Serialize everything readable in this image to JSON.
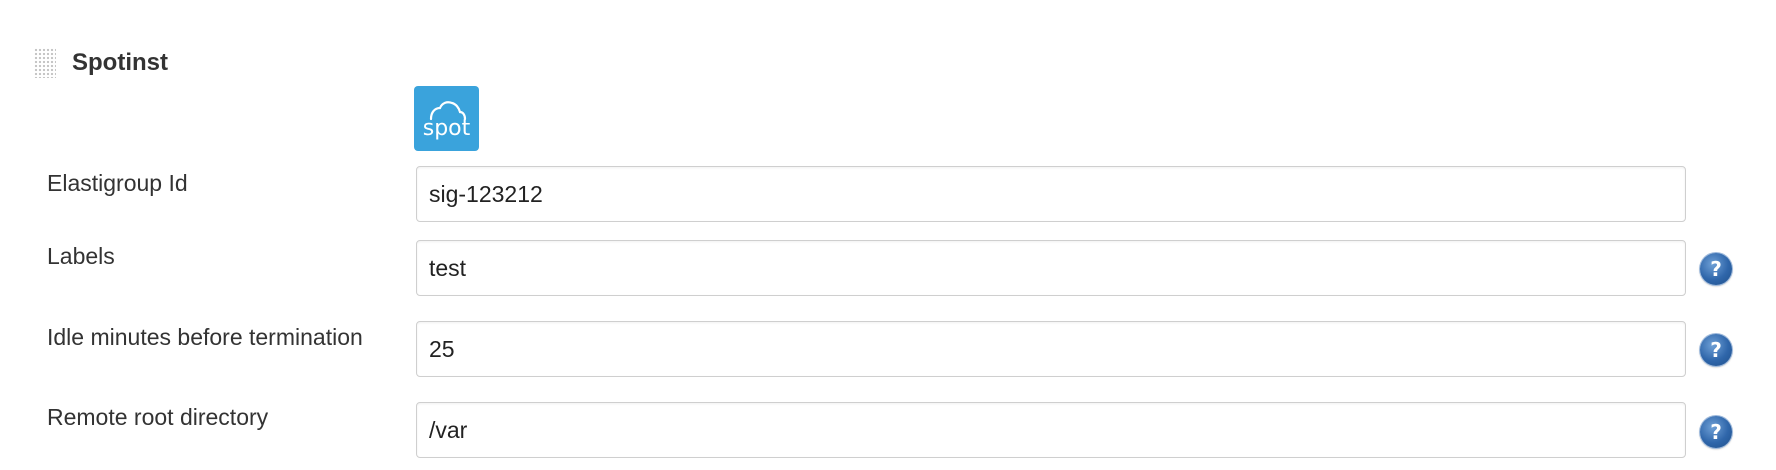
{
  "section": {
    "title": "Spotinst"
  },
  "logo": {
    "text": "spot",
    "icon": "cloud-icon",
    "color": "#3aa3dc"
  },
  "fields": [
    {
      "label": "Elastigroup Id",
      "value": "sig-123212",
      "has_help": false
    },
    {
      "label": "Labels",
      "value": "test",
      "has_help": true
    },
    {
      "label": "Idle minutes before termination",
      "value": "25",
      "has_help": true
    },
    {
      "label": "Remote root directory",
      "value": "/var",
      "has_help": true
    }
  ],
  "help": {
    "glyph": "?",
    "icon": "help-icon",
    "color": "#2f66aa"
  }
}
